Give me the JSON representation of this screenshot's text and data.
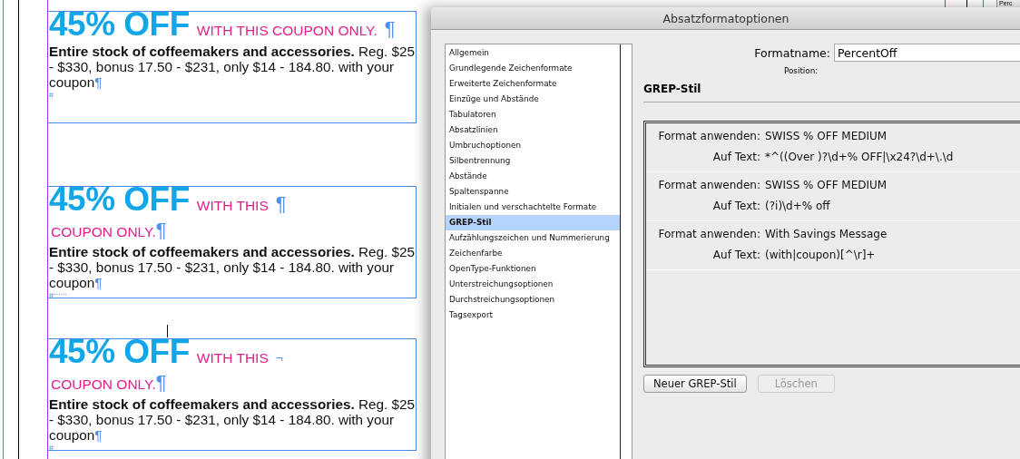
{
  "document": {
    "frames": [
      {
        "headline": "45% OFF",
        "tagline_lines": [
          {
            "text": "WITH THIS COUPON ONLY.",
            "mark": "¶"
          }
        ],
        "body": "**Entire stock of coffeemakers and accessories.** Reg. $25 - $330, bonus 17.50 - $231, only $14 - 184.80. with your coupon",
        "body_mark": "¶",
        "end_marker": "#"
      },
      {
        "headline": "45% OFF",
        "tagline_lines": [
          {
            "text": "WITH THIS",
            "mark": "¶"
          },
          {
            "text": "COUPON ONLY.",
            "mark": "¶"
          }
        ],
        "body": "**Entire stock of coffeemakers and accessories.** Reg. $25 - $330, bonus 17.50 - $231, only $14 - 184.80. with your coupon",
        "body_mark": "¶",
        "end_marker": "#::::::"
      },
      {
        "headline": "45% OFF",
        "tagline_lines": [
          {
            "text": "WITH THIS",
            "mark": "¬"
          },
          {
            "text": "COUPON ONLY.",
            "mark": "¶"
          }
        ],
        "body": "**Entire stock of coffeemakers and accessories.** Reg. $25 - $330, bonus 17.50 - $231, only $14 - 184.80. with your coupon",
        "body_mark": "¶",
        "end_marker": "#"
      }
    ],
    "corner_panel": "Perc"
  },
  "dialog": {
    "title": "Absatzformatoptionen",
    "sidebar": {
      "items": [
        {
          "label": "Allgemein",
          "selected": false
        },
        {
          "label": "Grundlegende Zeichenformate",
          "selected": false
        },
        {
          "label": "Erweiterte Zeichenformate",
          "selected": false
        },
        {
          "label": "Einzüge und Abstände",
          "selected": false
        },
        {
          "label": "Tabulatoren",
          "selected": false
        },
        {
          "label": "Absatzlinien",
          "selected": false
        },
        {
          "label": "Umbruchoptionen",
          "selected": false
        },
        {
          "label": "Silbentrennung",
          "selected": false
        },
        {
          "label": "Abstände",
          "selected": false
        },
        {
          "label": "Spaltenspanne",
          "selected": false
        },
        {
          "label": "Initialen und verschachtelte Formate",
          "selected": false
        },
        {
          "label": "GREP-Stil",
          "selected": true
        },
        {
          "label": "Aufzählungszeichen und Nummerierung",
          "selected": false
        },
        {
          "label": "Zeichenfarbe",
          "selected": false
        },
        {
          "label": "OpenType-Funktionen",
          "selected": false
        },
        {
          "label": "Unterstreichungsoptionen",
          "selected": false
        },
        {
          "label": "Durchstreichungsoptionen",
          "selected": false
        },
        {
          "label": "Tagsexport",
          "selected": false
        }
      ]
    },
    "format_name": {
      "label": "Formatname:",
      "value": "PercentOff"
    },
    "position_label": "Position:",
    "section_title": "GREP-Stil",
    "grep_styles": [
      {
        "apply_label": "Format anwenden:",
        "apply_value": "SWISS % OFF MEDIUM",
        "text_label": "Auf Text:",
        "text_value": "*^((Over )?\\d+% OFF|\\x24?\\d+\\.\\d"
      },
      {
        "apply_label": "Format anwenden:",
        "apply_value": "SWISS % OFF MEDIUM",
        "text_label": "Auf Text:",
        "text_value": "(?i)\\d+% off"
      },
      {
        "apply_label": "Format anwenden:",
        "apply_value": "With Savings Message",
        "text_label": "Auf Text:",
        "text_value": "(with|coupon)[^\\r]+"
      }
    ],
    "buttons": [
      {
        "label": "Neuer GREP-Stil",
        "disabled": false
      },
      {
        "label": "Löschen",
        "disabled": true
      }
    ]
  }
}
